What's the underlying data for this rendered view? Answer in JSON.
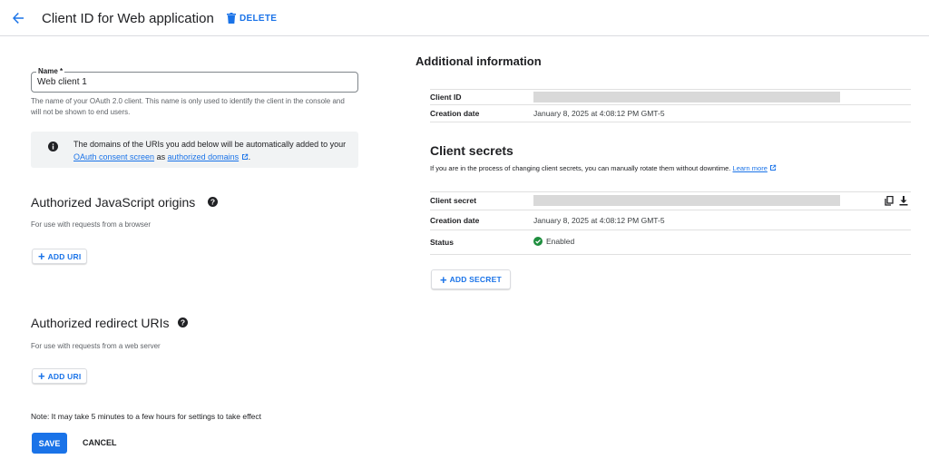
{
  "header": {
    "title": "Client ID for Web application",
    "delete_label": "DELETE"
  },
  "form": {
    "name_label": "Name *",
    "name_value": "Web client 1",
    "name_hint": "The name of your OAuth 2.0 client. This name is only used to identify the client in the console and will not be shown to end users.",
    "notice_part1": "The domains of the URIs you add below will be automatically added to your ",
    "notice_link1": "OAuth consent screen",
    "notice_part2": " as ",
    "notice_link2": "authorized domains",
    "notice_part3": ".",
    "js_origins_title": "Authorized JavaScript origins",
    "js_origins_sub": "For use with requests from a browser",
    "add_uri_label": "ADD URI",
    "redirect_title": "Authorized redirect URIs",
    "redirect_sub": "For use with requests from a web server",
    "note": "Note: It may take 5 minutes to a few hours for settings to take effect",
    "save_label": "SAVE",
    "cancel_label": "CANCEL"
  },
  "additional_info": {
    "title": "Additional information",
    "client_id_label": "Client ID",
    "creation_date_label": "Creation date",
    "creation_date_value": "January 8, 2025 at 4:08:12 PM GMT-5"
  },
  "client_secrets": {
    "title": "Client secrets",
    "description": "If you are in the process of changing client secrets, you can manually rotate them without downtime.",
    "learn_more": "Learn more",
    "secret_label": "Client secret",
    "creation_date_label": "Creation date",
    "creation_date_value": "January 8, 2025 at 4:08:12 PM GMT-5",
    "status_label": "Status",
    "status_value": "Enabled",
    "add_secret_label": "ADD SECRET"
  },
  "colors": {
    "accent": "#1a73e8",
    "success": "#1e8e3e",
    "redacted": "#d9d9d9"
  }
}
